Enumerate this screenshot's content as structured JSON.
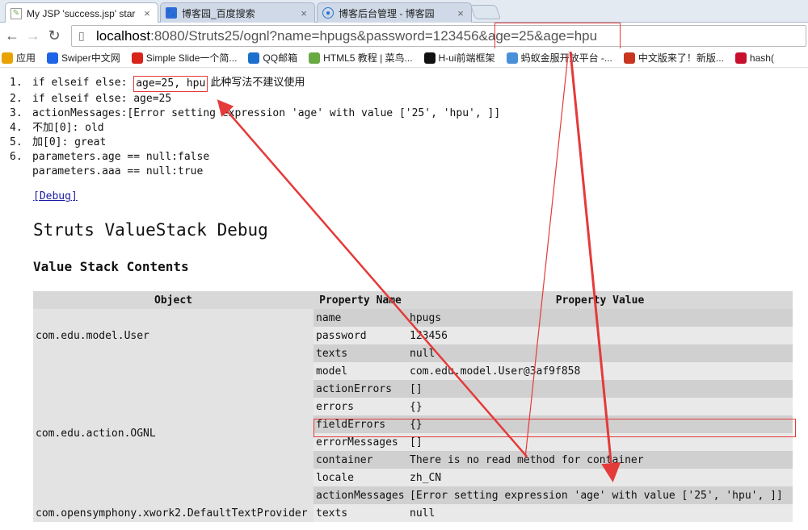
{
  "browser": {
    "tabs": [
      {
        "label": "My JSP 'success.jsp' star",
        "icon": "jsp-page-icon",
        "active": true
      },
      {
        "label": "博客园_百度搜索",
        "icon": "baidu-paw-icon",
        "active": false
      },
      {
        "label": "博客后台管理 - 博客园",
        "icon": "cnblogs-icon",
        "active": false
      }
    ],
    "url": {
      "host": "localhost",
      "rest": ":8080/Struts25/ognl?name=hpugs&password=123456&age=25&age=hpu"
    },
    "bookmarks": [
      {
        "label": "应用",
        "icon": "apps-grid-icon",
        "color": "#e8a300"
      },
      {
        "label": "Swiper中文网",
        "icon": "swiper-icon",
        "color": "#1e64e6"
      },
      {
        "label": "Simple Slide一个简...",
        "icon": "simple-slide-icon",
        "color": "#d9241c"
      },
      {
        "label": "QQ邮箱",
        "icon": "qq-mail-icon",
        "color": "#1c6fcc"
      },
      {
        "label": "HTML5 教程 | 菜鸟...",
        "icon": "runoob-icon",
        "color": "#6aa843"
      },
      {
        "label": "H-ui前端框架",
        "icon": "hui-icon",
        "color": "#111111"
      },
      {
        "label": "蚂蚁金服开放平台 -...",
        "icon": "ant-icon",
        "color": "#4a90d9"
      },
      {
        "label": "中文版来了！新版...",
        "icon": "news-icon",
        "color": "#c8361f"
      },
      {
        "label": "hash(",
        "icon": "hash-icon",
        "color": "#c8102e"
      }
    ]
  },
  "page": {
    "lines": [
      {
        "num": "1.",
        "code": "if elseif else: ",
        "highlight": "age=25, hpu",
        "note": "此种写法不建议使用"
      },
      {
        "num": "2.",
        "code": "if elseif else: age=25"
      },
      {
        "num": "3.",
        "code": "actionMessages:[Error setting expression 'age' with value ['25', 'hpu', ]]"
      },
      {
        "num": "4.",
        "prefix": "不加",
        "code": "[0]: old"
      },
      {
        "num": "5.",
        "prefix": "加",
        "code": "[0]: great"
      },
      {
        "num": "6.",
        "code": "parameters.age == null:false"
      },
      {
        "num": "",
        "code": "parameters.aaa == null:true"
      }
    ],
    "debug_link": "[Debug]",
    "heading": "Struts ValueStack Debug",
    "subheading": "Value Stack Contents",
    "table": {
      "headers": [
        "Object",
        "Property Name",
        "Property Value"
      ],
      "groups": [
        {
          "object": "com.edu.model.User",
          "rows": [
            [
              "name",
              "hpugs"
            ],
            [
              "password",
              "123456"
            ],
            [
              "texts",
              "null"
            ]
          ]
        },
        {
          "object": "com.edu.action.OGNL",
          "rows": [
            [
              "model",
              "com.edu.model.User@3af9f858"
            ],
            [
              "actionErrors",
              "[]"
            ],
            [
              "errors",
              "{}"
            ],
            [
              "fieldErrors",
              "{}"
            ],
            [
              "errorMessages",
              "[]"
            ],
            [
              "container",
              "There is no read method for container"
            ],
            [
              "locale",
              "zh_CN"
            ],
            [
              "actionMessages",
              "[Error setting expression 'age' with value ['25', 'hpu', ]]"
            ]
          ]
        },
        {
          "object": "com.opensymphony.xwork2.DefaultTextProvider",
          "rows": [
            [
              "texts",
              "null"
            ]
          ]
        }
      ]
    }
  },
  "annotation_color": "#e53a3a"
}
